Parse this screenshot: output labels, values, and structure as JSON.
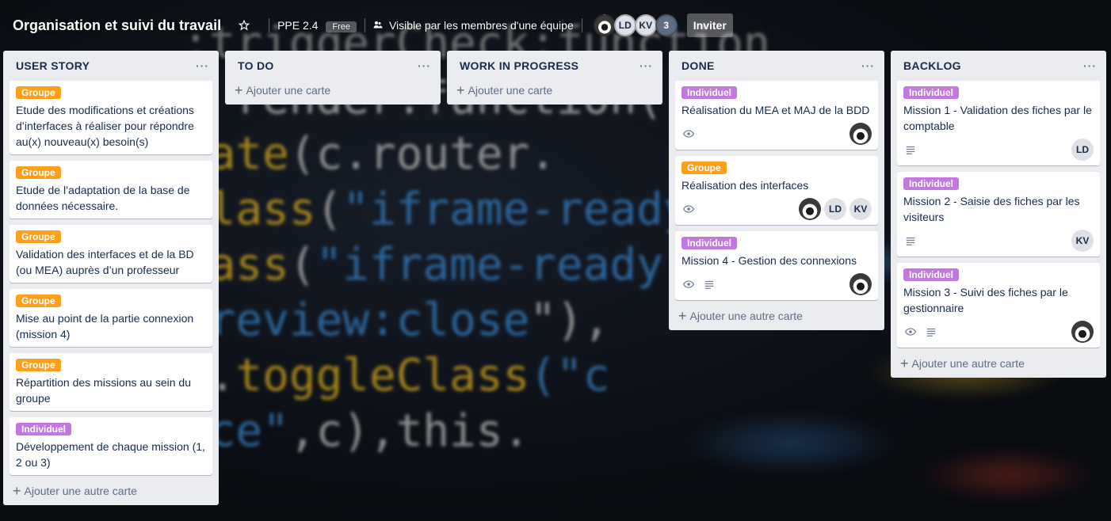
{
  "header": {
    "board_title": "Organisation et suivi du travail",
    "team_name": "PPE 2.4",
    "plan_badge": "Free",
    "visibility": "Visible par les membres d'une équipe",
    "members": [
      "LD",
      "KV"
    ],
    "extra_member_count": "3",
    "invite_label": "Inviter"
  },
  "lists": [
    {
      "title": "USER STORY",
      "add_label": "Ajouter une autre carte",
      "cards": [
        {
          "label": "Groupe",
          "title": "Etude des modifications et créations d’interfaces à réaliser pour répondre au(x) nouveau(x) besoin(s)"
        },
        {
          "label": "Groupe",
          "title": "Etude de l’adaptation de la base de données nécessaire."
        },
        {
          "label": "Groupe",
          "title": "Validation des interfaces et de la BD (ou MEA) auprès d’un professeur"
        },
        {
          "label": "Groupe",
          "title": "Mise au point de la partie connexion (mission 4)"
        },
        {
          "label": "Groupe",
          "title": "Répartition des missions au sein du groupe"
        },
        {
          "label": "Individuel",
          "title": "Développement de chaque mission (1, 2 ou 3)"
        }
      ]
    },
    {
      "title": "TO DO",
      "add_label": "Ajouter une carte",
      "cards": []
    },
    {
      "title": "WORK IN PROGRESS",
      "add_label": "Ajouter une carte",
      "cards": []
    },
    {
      "title": "DONE",
      "add_label": "Ajouter une autre carte",
      "cards": [
        {
          "label": "Individuel",
          "title": "Réalisation du MEA et MAJ de la BDD"
        },
        {
          "label": "Groupe",
          "title": "Réalisation des interfaces",
          "members": [
            "LD",
            "KV"
          ]
        },
        {
          "label": "Individuel",
          "title": "Mission 4 - Gestion des connexions"
        }
      ]
    },
    {
      "title": "BACKLOG",
      "add_label": "Ajouter une autre carte",
      "cards": [
        {
          "label": "Individuel",
          "title": "Mission 1 - Validation des fiches par le comptable",
          "members": [
            "LD"
          ]
        },
        {
          "label": "Individuel",
          "title": "Mission 2 - Saisie des fiches par les visiteurs",
          "members": [
            "KV"
          ]
        },
        {
          "label": "Individuel",
          "title": "Mission 3 - Suivi des fiches par le gestionnaire"
        }
      ]
    }
  ],
  "colors": {
    "label_groupe": "#ff9f1a",
    "label_individuel": "#c377e0",
    "list_bg": "#ebecf0"
  },
  "icons": {
    "watch": "eye-icon",
    "description": "description-icon",
    "star": "star-icon",
    "visibility": "team-visibility-icon",
    "list_menu": "more-horizontal-icon",
    "add": "plus-icon"
  }
}
